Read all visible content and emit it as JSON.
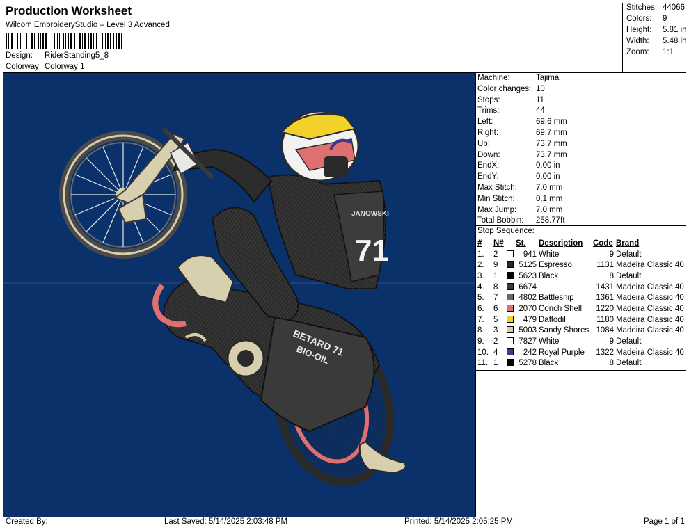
{
  "header": {
    "title": "Production Worksheet",
    "subtitle": "Wilcom EmbroideryStudio – Level 3 Advanced",
    "design_label": "Design:",
    "design_value": "RiderStanding5_8",
    "colorway_label": "Colorway:",
    "colorway_value": "Colorway 1"
  },
  "stats": [
    {
      "label": "Stitches:",
      "value": "44066"
    },
    {
      "label": "Colors:",
      "value": "9"
    },
    {
      "label": "Height:",
      "value": "5.81 in"
    },
    {
      "label": "Width:",
      "value": "5.48 in"
    },
    {
      "label": "Zoom:",
      "value": "1:1"
    }
  ],
  "machine_info": [
    {
      "label": "Machine:",
      "value": "Tajima"
    },
    {
      "label": "Color changes:",
      "value": "10"
    },
    {
      "label": "Stops:",
      "value": "11"
    },
    {
      "label": "Trims:",
      "value": "44"
    },
    {
      "label": "Left:",
      "value": "69.6 mm"
    },
    {
      "label": "Right:",
      "value": "69.7 mm"
    },
    {
      "label": "Up:",
      "value": "73.7 mm"
    },
    {
      "label": "Down:",
      "value": "73.7 mm"
    },
    {
      "label": "EndX:",
      "value": "0.00 in"
    },
    {
      "label": "EndY:",
      "value": "0.00 in"
    },
    {
      "label": "Max Stitch:",
      "value": "7.0 mm"
    },
    {
      "label": "Min Stitch:",
      "value": "0.1 mm"
    },
    {
      "label": "Max Jump:",
      "value": "7.0 mm"
    },
    {
      "label": "Total Bobbin:",
      "value": "258.77ft"
    }
  ],
  "stop_sequence": {
    "title": "Stop Sequence:",
    "headers": {
      "num": "#",
      "n": "N#",
      "st": "St.",
      "desc": "Description",
      "code": "Code",
      "brand": "Brand"
    },
    "rows": [
      {
        "num": "1.",
        "n": "2",
        "color": "#ffffff",
        "st": "941",
        "desc": "White",
        "code": "9",
        "brand": "Default"
      },
      {
        "num": "2.",
        "n": "9",
        "color": "#2a2422",
        "st": "5125",
        "desc": "Espresso",
        "code": "1131",
        "brand": "Madeira Classic 40"
      },
      {
        "num": "3.",
        "n": "1",
        "color": "#000000",
        "st": "5623",
        "desc": "Black",
        "code": "8",
        "brand": "Default"
      },
      {
        "num": "4.",
        "n": "8",
        "color": "#3a3a3a",
        "st": "6674",
        "desc": "",
        "code": "1431",
        "brand": "Madeira Classic 40"
      },
      {
        "num": "5.",
        "n": "7",
        "color": "#6a6a6a",
        "st": "4802",
        "desc": "Battleship",
        "code": "1361",
        "brand": "Madeira Classic 40"
      },
      {
        "num": "6.",
        "n": "6",
        "color": "#e07070",
        "st": "2070",
        "desc": "Conch Shell",
        "code": "1220",
        "brand": "Madeira Classic 40"
      },
      {
        "num": "7.",
        "n": "5",
        "color": "#f2d22a",
        "st": "479",
        "desc": "Daffodil",
        "code": "1180",
        "brand": "Madeira Classic 40"
      },
      {
        "num": "8.",
        "n": "3",
        "color": "#d9cfb0",
        "st": "5003",
        "desc": "Sandy Shores",
        "code": "1084",
        "brand": "Madeira Classic 40"
      },
      {
        "num": "9.",
        "n": "2",
        "color": "#ffffff",
        "st": "7827",
        "desc": "White",
        "code": "9",
        "brand": "Default"
      },
      {
        "num": "10.",
        "n": "4",
        "color": "#3a3a8c",
        "st": "242",
        "desc": "Royal Purple",
        "code": "1322",
        "brand": "Madeira Classic 40"
      },
      {
        "num": "11.",
        "n": "1",
        "color": "#000000",
        "st": "5278",
        "desc": "Black",
        "code": "8",
        "brand": "Default"
      }
    ]
  },
  "design_image": {
    "background": "#0a3169",
    "texts": {
      "janowski": "JANOWSKI",
      "number": "71",
      "betard": "BETARD 71",
      "biooil": "BIO-OIL"
    }
  },
  "footer": {
    "created_by": "Created By:",
    "last_saved": "Last Saved: 5/14/2025 2:03:48 PM",
    "printed": "Printed: 5/14/2025 2:05:25 PM",
    "page": "Page 1 of 1"
  }
}
